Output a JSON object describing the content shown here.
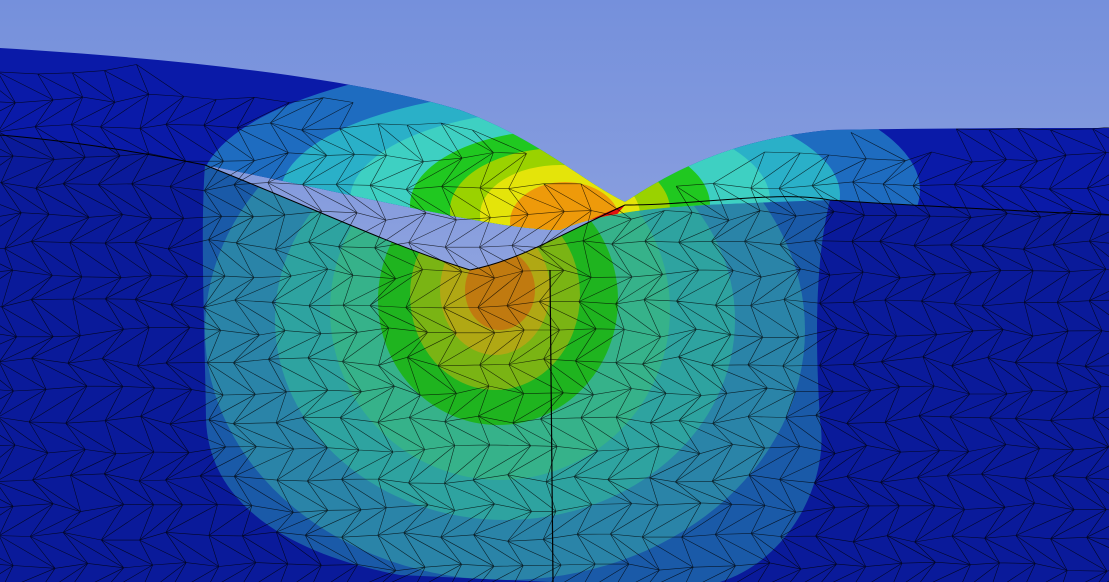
{
  "viewport": {
    "background_top": "#7590dc",
    "background_bottom": "#a8b6e2",
    "mesh_line_color": "#000000",
    "contour_colors": {
      "minimum": "#0a1a9a",
      "low": "#1d4fb8",
      "low_mid": "#2ea3c4",
      "mid": "#3fd0c6",
      "mid_high": "#20c820",
      "high": "#9ad200",
      "higher": "#e4e40a",
      "near_max": "#ee9a0a",
      "maximum": "#e01010"
    },
    "cut_face_tint": "#2aa0a0"
  }
}
